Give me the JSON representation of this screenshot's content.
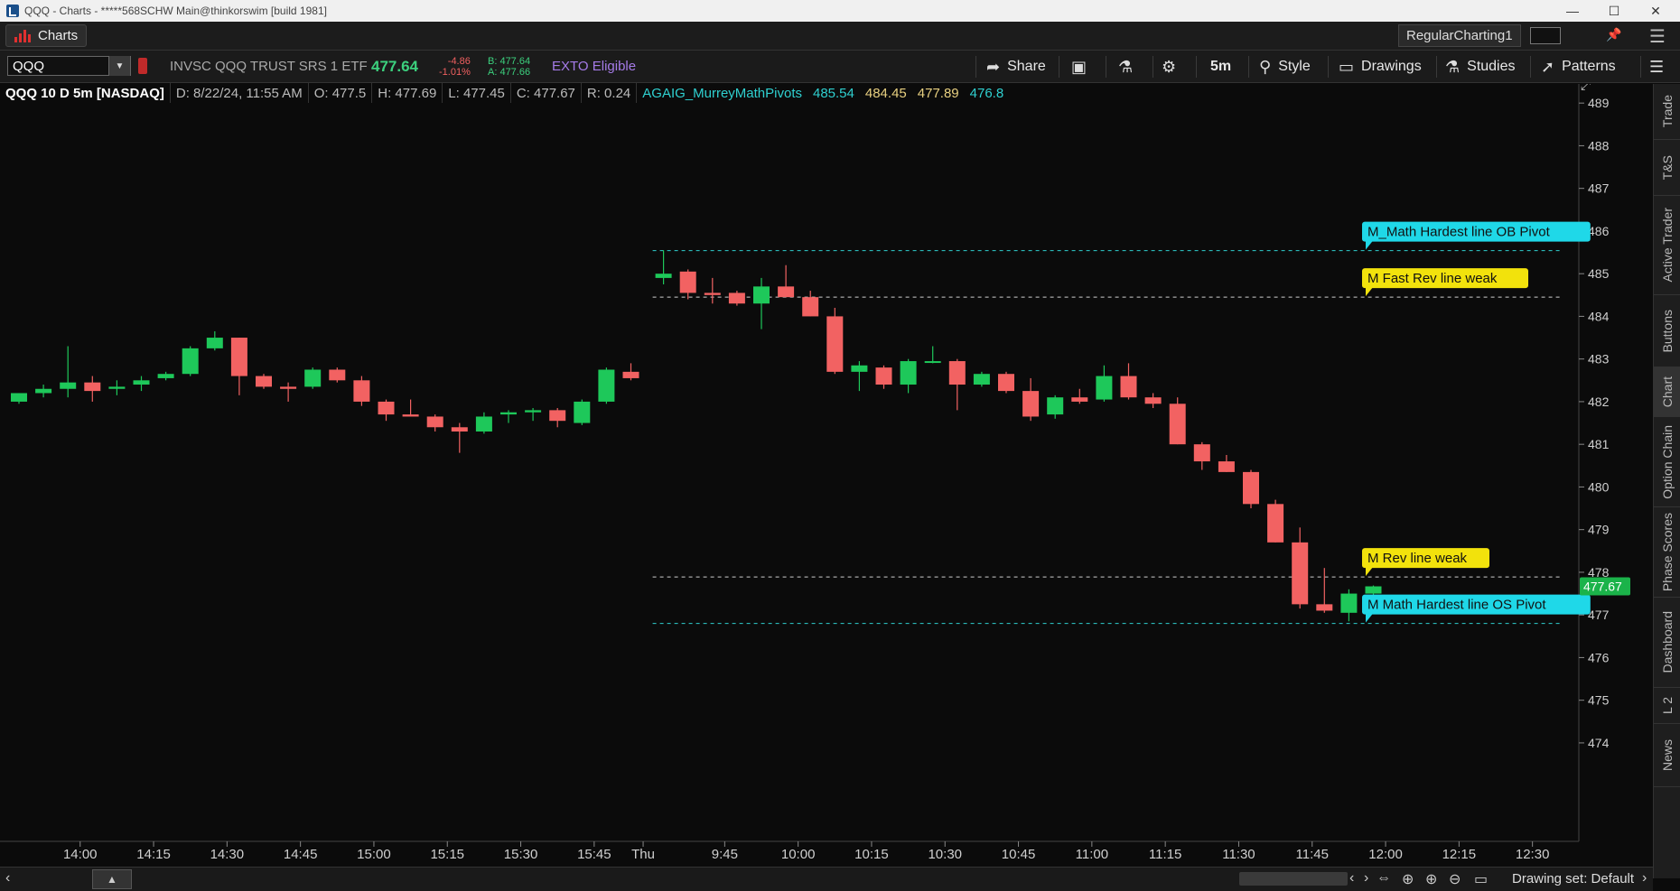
{
  "window": {
    "title": "QQQ - Charts - *****568SCHW Main@thinkorswim [build 1981]",
    "controls": {
      "minimize": "—",
      "maximize": "☐",
      "close": "✕"
    }
  },
  "tabbar": {
    "active_tab": "Charts",
    "chart_name": "RegularCharting1",
    "icons": {
      "pin": "pin-icon",
      "menu": "menu-icon"
    }
  },
  "toolbar": {
    "symbol": "QQQ",
    "description": "INVSC QQQ TRUST SRS 1 ETF",
    "last_price": "477.64",
    "net_change": "-4.86",
    "pct_change": "-1.01%",
    "bid": "B: 477.64",
    "ask": "A: 477.66",
    "exto": "EXTO Eligible",
    "share_label": "Share",
    "timeframe": "5m",
    "style_label": "Style",
    "drawings_label": "Drawings",
    "studies_label": "Studies",
    "patterns_label": "Patterns"
  },
  "info_bar": {
    "title": "QQQ 10 D 5m [NASDAQ]",
    "date": "D: 8/22/24, 11:55 AM",
    "open": "O: 477.5",
    "high": "H: 477.69",
    "low": "L: 477.45",
    "close": "C: 477.67",
    "range": "R: 0.24",
    "indicator": "AGAIG_MurreyMathPivots",
    "ind_values": [
      "485.54",
      "484.45",
      "477.89",
      "476.8"
    ]
  },
  "chart_data": {
    "type": "candlestick",
    "symbol": "QQQ",
    "interval": "5m",
    "ylim": [
      473.3,
      489.3
    ],
    "yticks": [
      474,
      475,
      476,
      477,
      478,
      479,
      480,
      481,
      482,
      483,
      484,
      485,
      486,
      487,
      488,
      489
    ],
    "xticks": [
      {
        "label": "14:00",
        "i": 2.5
      },
      {
        "label": "14:15",
        "i": 5.5
      },
      {
        "label": "14:30",
        "i": 8.5
      },
      {
        "label": "14:45",
        "i": 11.5
      },
      {
        "label": "15:00",
        "i": 14.5
      },
      {
        "label": "15:15",
        "i": 17.5
      },
      {
        "label": "15:30",
        "i": 20.5
      },
      {
        "label": "15:45",
        "i": 23.5
      },
      {
        "label": "Thu",
        "i": 25.5
      },
      {
        "label": "9:45",
        "i": 28.5
      },
      {
        "label": "10:00",
        "i": 31.5
      },
      {
        "label": "10:15",
        "i": 34.5
      },
      {
        "label": "10:30",
        "i": 37.5
      },
      {
        "label": "10:45",
        "i": 40.5
      },
      {
        "label": "11:00",
        "i": 43.5
      },
      {
        "label": "11:15",
        "i": 46.5
      },
      {
        "label": "11:30",
        "i": 49.5
      },
      {
        "label": "11:45",
        "i": 52.5
      },
      {
        "label": "12:00",
        "i": 55.5
      },
      {
        "label": "12:15",
        "i": 58.5
      },
      {
        "label": "12:30",
        "i": 61.5
      }
    ],
    "candles": [
      [
        482.0,
        482.2,
        481.95,
        482.2
      ],
      [
        482.2,
        482.4,
        482.1,
        482.3
      ],
      [
        482.3,
        483.3,
        482.1,
        482.45
      ],
      [
        482.45,
        482.6,
        482.0,
        482.25
      ],
      [
        482.3,
        482.5,
        482.15,
        482.35
      ],
      [
        482.4,
        482.6,
        482.25,
        482.5
      ],
      [
        482.55,
        482.7,
        482.5,
        482.65
      ],
      [
        482.65,
        483.3,
        482.6,
        483.25
      ],
      [
        483.25,
        483.65,
        483.2,
        483.5
      ],
      [
        483.5,
        483.5,
        482.15,
        482.6
      ],
      [
        482.6,
        482.65,
        482.3,
        482.35
      ],
      [
        482.35,
        482.45,
        482.0,
        482.3
      ],
      [
        482.35,
        482.8,
        482.3,
        482.75
      ],
      [
        482.75,
        482.8,
        482.45,
        482.5
      ],
      [
        482.5,
        482.6,
        481.9,
        482.0
      ],
      [
        482.0,
        482.05,
        481.55,
        481.7
      ],
      [
        481.7,
        482.05,
        481.65,
        481.65
      ],
      [
        481.65,
        481.7,
        481.3,
        481.4
      ],
      [
        481.4,
        481.5,
        480.8,
        481.3
      ],
      [
        481.3,
        481.75,
        481.25,
        481.65
      ],
      [
        481.7,
        481.8,
        481.5,
        481.75
      ],
      [
        481.75,
        481.85,
        481.55,
        481.8
      ],
      [
        481.8,
        481.85,
        481.4,
        481.55
      ],
      [
        481.5,
        482.05,
        481.45,
        482.0
      ],
      [
        482.0,
        482.8,
        481.95,
        482.75
      ],
      [
        482.7,
        482.9,
        482.5,
        482.55
      ],
      [
        484.9,
        485.55,
        484.75,
        485.0
      ],
      [
        485.05,
        485.1,
        484.4,
        484.55
      ],
      [
        484.55,
        484.9,
        484.3,
        484.5
      ],
      [
        484.55,
        484.6,
        484.25,
        484.3
      ],
      [
        484.3,
        484.9,
        483.7,
        484.7
      ],
      [
        484.7,
        485.2,
        484.5,
        484.45
      ],
      [
        484.45,
        484.6,
        484.0,
        484.0
      ],
      [
        484.0,
        484.2,
        482.65,
        482.7
      ],
      [
        482.7,
        482.95,
        482.25,
        482.85
      ],
      [
        482.8,
        482.85,
        482.3,
        482.4
      ],
      [
        482.4,
        483.0,
        482.2,
        482.95
      ],
      [
        482.95,
        483.3,
        482.9,
        482.95
      ],
      [
        482.95,
        483.0,
        481.8,
        482.4
      ],
      [
        482.4,
        482.7,
        482.35,
        482.65
      ],
      [
        482.65,
        482.7,
        482.2,
        482.25
      ],
      [
        482.25,
        482.55,
        481.55,
        481.65
      ],
      [
        481.7,
        482.15,
        481.6,
        482.1
      ],
      [
        482.1,
        482.3,
        481.95,
        482.0
      ],
      [
        482.05,
        482.85,
        482.0,
        482.6
      ],
      [
        482.6,
        482.9,
        482.05,
        482.1
      ],
      [
        482.1,
        482.2,
        481.85,
        481.95
      ],
      [
        481.95,
        482.1,
        481.0,
        481.0
      ],
      [
        481.0,
        481.05,
        480.4,
        480.6
      ],
      [
        480.6,
        480.75,
        480.35,
        480.35
      ],
      [
        480.35,
        480.4,
        479.5,
        479.6
      ],
      [
        479.6,
        479.7,
        478.7,
        478.7
      ],
      [
        478.7,
        479.05,
        477.15,
        477.25
      ],
      [
        477.25,
        478.1,
        477.05,
        477.1
      ],
      [
        477.05,
        477.6,
        476.85,
        477.5
      ],
      [
        477.5,
        477.69,
        477.45,
        477.67
      ]
    ],
    "gap_after": 26,
    "levels": [
      {
        "name": "M_Math Hardest line OB Pivot",
        "value": 485.54,
        "color": "#2fd0d0",
        "label_bg": "#1fd8e8"
      },
      {
        "name": "M Fast Rev line weak",
        "value": 484.45,
        "color": "#cfcfcf",
        "label_bg": "#f2e20c"
      },
      {
        "name": "M Rev line weak",
        "value": 477.89,
        "color": "#cfcfcf",
        "label_bg": "#f2e20c"
      },
      {
        "name": "M Math Hardest line OS Pivot",
        "value": 476.8,
        "color": "#2fd0d0",
        "label_bg": "#1fd8e8"
      }
    ],
    "last_price_tag": "477.67",
    "colors": {
      "up": "#1ec85a",
      "down": "#f26262",
      "bg": "#0b0b0b",
      "axis_text": "#cfcfcf",
      "price_tag": "#1bb34a"
    }
  },
  "side_tabs": [
    "Trade",
    "T&S",
    "Active Trader",
    "Buttons",
    "Chart",
    "Option Chain",
    "Phase Scores",
    "Dashboard",
    "L 2",
    "News"
  ],
  "side_tab_active": "Chart",
  "bottom": {
    "drawing_set": "Drawing set: Default"
  }
}
